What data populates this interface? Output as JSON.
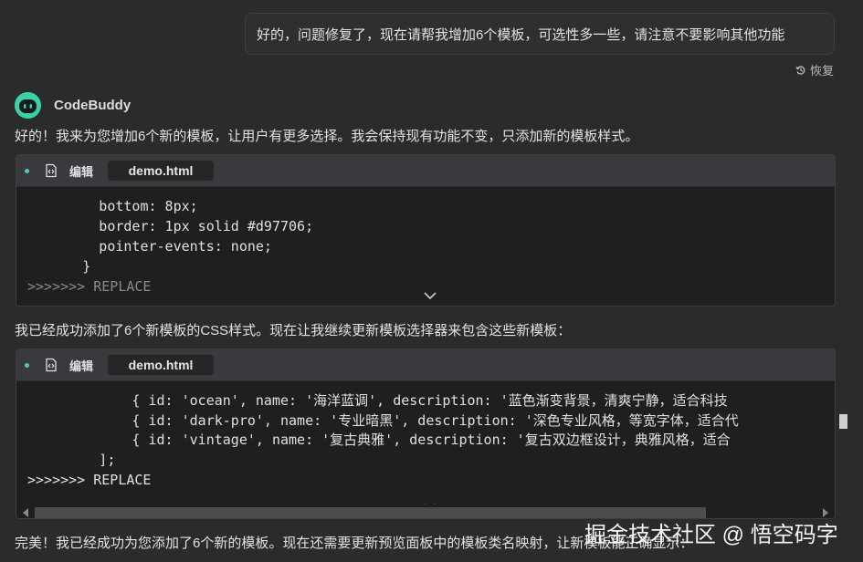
{
  "user_message": "好的，问题修复了，现在请帮我增加6个模板，可选性多一些，请注意不要影响其他功能",
  "restore_label": "恢复",
  "assistant_name": "CodeBuddy",
  "messages": {
    "intro": "好的！我来为您增加6个新的模板，让用户有更多选择。我会保持现有功能不变，只添加新的模板样式。",
    "middle": "我已经成功添加了6个新模板的CSS样式。现在让我继续更新模板选择器来包含这些新模板：",
    "final": "完美！我已经成功为您添加了6个新的模板。现在还需要更新预览面板中的模板类名映射，让新模板能正确显示："
  },
  "code_blocks": [
    {
      "edit_label": "编辑",
      "file_name": "demo.html",
      "lines": [
        "          bottom: 8px;",
        "          border: 1px solid #d97706;",
        "          pointer-events: none;",
        "        }",
        ">>>>>>> REPLACE"
      ]
    },
    {
      "edit_label": "编辑",
      "file_name": "demo.html",
      "lines": [
        "              { id: 'ocean', name: '海洋蓝调', description: '蓝色渐变背景，清爽宁静，适合科技",
        "              { id: 'dark-pro', name: '专业暗黑', description: '深色专业风格，等宽字体，适合代",
        "              { id: 'vintage', name: '复古典雅', description: '复古双边框设计，典雅风格，适合",
        "          ];",
        ">>>>>>> REPLACE"
      ]
    }
  ],
  "watermark": "掘金技术社区 @ 悟空码字",
  "colors": {
    "background": "#2b2b2b",
    "code_background": "#1f1f1f",
    "header_background": "#3a3a3e",
    "accent": "#4ecdb4",
    "avatar": "#39d1a8"
  }
}
